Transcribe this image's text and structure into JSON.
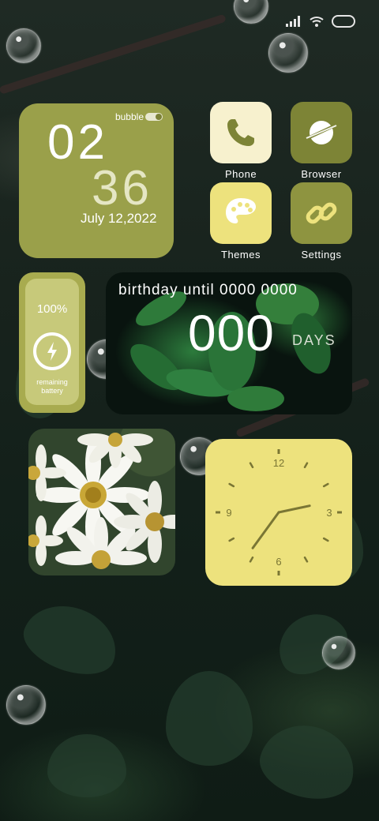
{
  "widgets": {
    "clock": {
      "toggle_label": "bubble",
      "hour": "02",
      "minute": "36",
      "date": "July 12,2022"
    },
    "battery": {
      "percent": "100%",
      "percent_value": 100,
      "label": "remaining battery"
    },
    "birthday": {
      "title": "birthday until 0000  0000",
      "days": "000",
      "days_label": "DAYS"
    },
    "analog_clock": {
      "numerals": [
        "12",
        "3",
        "6",
        "9"
      ],
      "time": "02:36"
    }
  },
  "apps": [
    {
      "label": "Phone",
      "icon": "phone-icon",
      "tile_color": "#f7f1ce",
      "glyph_color": "#7d8436"
    },
    {
      "label": "Browser",
      "icon": "browser-icon",
      "tile_color": "#7d8436",
      "glyph_color": "#ffffff"
    },
    {
      "label": "Themes",
      "icon": "palette-icon",
      "tile_color": "#ede27d",
      "glyph_color": "#ffffff"
    },
    {
      "label": "Settings",
      "icon": "link-icon",
      "tile_color": "#8e9440",
      "glyph_color": "#ede27d"
    }
  ],
  "colors": {
    "olive": "#9aa04a",
    "pale_yellow": "#ede27d",
    "cream": "#f7f1ce",
    "dark_olive": "#7d8436"
  }
}
